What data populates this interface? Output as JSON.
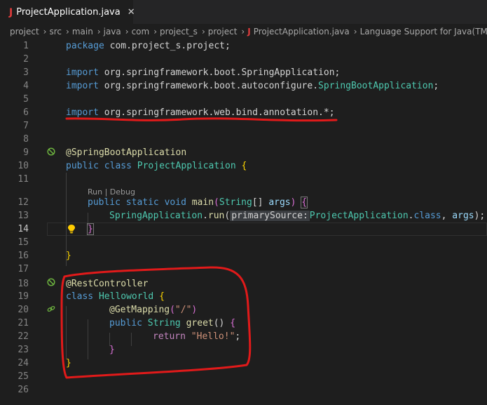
{
  "tab": {
    "icon_letter": "J",
    "title": "ProjectApplication.java",
    "close": "✕"
  },
  "breadcrumb": {
    "folders": [
      "project",
      "src",
      "main",
      "java",
      "com",
      "project_s",
      "project"
    ],
    "file_icon": "J",
    "file": "ProjectApplication.java",
    "symbol": "Language Support for Java(TM)"
  },
  "editor": {
    "line_numbers": [
      "1",
      "2",
      "3",
      "4",
      "5",
      "6",
      "7",
      "8",
      "9",
      "10",
      "11",
      "12",
      "13",
      "14",
      "15",
      "16",
      "17",
      "18",
      "19",
      "20",
      "21",
      "22",
      "23",
      "24",
      "25",
      "26"
    ],
    "active_line": "14",
    "codelens": "Run | Debug",
    "param_hint": "primarySource:",
    "tokens": {
      "package": "package",
      "pkgname": "com.project_s.project;",
      "import": "import",
      "imp1": "org.springframework.boot.SpringApplication;",
      "imp2a": "org.springframework.boot.autoconfigure.",
      "imp2b": "SpringBootApplication",
      "imp2c": ";",
      "imp3": "org.springframework.web.bind.annotation.*;",
      "anno1": "@SpringBootApplication",
      "public": "public",
      "class": "class",
      "static": "static",
      "void": "void",
      "cls1": "ProjectApplication",
      "brace_open": "{",
      "brace_close": "}",
      "main": "main",
      "paren_open": "(",
      "paren_close": ")",
      "string_type": "String",
      "arr": "[]",
      "args": "args",
      "springapp": "SpringApplication",
      "dot": ".",
      "run": "run",
      "projapp": "ProjectApplication",
      "classkw": "class",
      "comma": ", ",
      "close13": ");",
      "anno2": "@RestController",
      "cls2": "Helloworld",
      "anno3": "@GetMapping",
      "mapping_arg": "\"/\"",
      "greet": "greet",
      "parens": "()",
      "return": "return",
      "hello": "\"Hello!\"",
      "semi": ";"
    }
  },
  "colors": {
    "background": "#1e1e1e",
    "keyword": "#569cd6",
    "type": "#4ec9b0",
    "function": "#dcdcaa",
    "variable": "#9cdcfe",
    "string": "#ce9178",
    "control": "#c586c0",
    "markup": "#e11a1a"
  },
  "icons": [
    "java-file-icon",
    "close-icon",
    "chevron-right-icon",
    "spring-boot-icon",
    "lightbulb-icon",
    "link-icon"
  ]
}
